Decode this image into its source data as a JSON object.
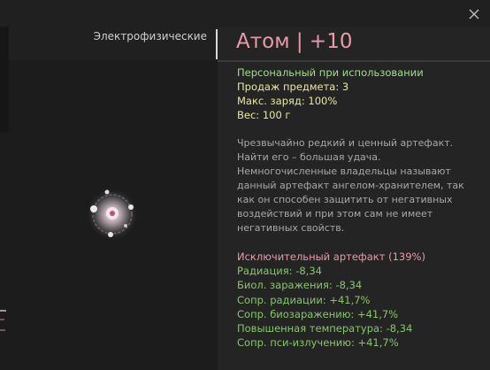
{
  "category": {
    "label": "Электрофизические"
  },
  "item": {
    "title": "Атом | +10",
    "properties": [
      {
        "text": "Персональный при использовании",
        "tone": "green"
      },
      {
        "text": "Продаж предмета: 3",
        "tone": "yellow"
      },
      {
        "text": "Макс. заряд: 100%",
        "tone": "yellow"
      },
      {
        "text": "Вес: 100 г",
        "tone": "yellow"
      }
    ],
    "description": "Чрезвычайно редкий и ценный артефакт. Найти его – большая удача. Немногочисленные владельцы называют данный артефакт ангелом-хранителем, так как он способен защитить от негативных воздействий и при этом сам не имеет негативных свойств.",
    "rarity": "Исключительный артефакт (139%)",
    "stats": [
      "Радиация: -8,34",
      "Биол. заражения: -8,34",
      "Сопр. радиации: +41,7%",
      "Сопр. биозаражению: +41,7%",
      "Повышенная температура: -8,34",
      "Сопр. пси-излучению: +41,7%"
    ]
  },
  "icons": {
    "close": "close-icon",
    "artifact": "atom-artifact-icon"
  },
  "colors": {
    "title": "#e89aa8",
    "green": "#9fe08a",
    "yellow": "#e9e9a0",
    "stat": "#86c76a",
    "description": "#a8a8a8"
  }
}
